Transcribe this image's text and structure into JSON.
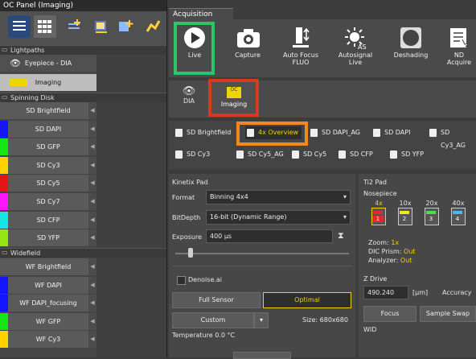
{
  "left_panel": {
    "title": "OC Panel (Imaging)",
    "sections": {
      "lightpaths": "Lightpaths",
      "spinning": "Spinning Disk",
      "widefield": "Widefield"
    },
    "lightpath_items": [
      {
        "label": "Eyepiece - DIA"
      },
      {
        "label": "Imaging"
      }
    ],
    "spinning_items": [
      {
        "label": "SD Brightfield",
        "color": "#5a5a5a"
      },
      {
        "label": "SD DAPI",
        "color": "#1414ff"
      },
      {
        "label": "SD GFP",
        "color": "#14e614"
      },
      {
        "label": "SD Cy3",
        "color": "#ffd200"
      },
      {
        "label": "SD Cy5",
        "color": "#e61414"
      },
      {
        "label": "SD Cy7",
        "color": "#ff14ff"
      },
      {
        "label": "SD CFP",
        "color": "#14e6e6"
      },
      {
        "label": "SD YFP",
        "color": "#96e614"
      }
    ],
    "widefield_items": [
      {
        "label": "WF Brightfield",
        "color": "#5a5a5a"
      },
      {
        "label": "WF DAPI",
        "color": "#1414ff"
      },
      {
        "label": "WF DAPI_focusing",
        "color": "#1414ff"
      },
      {
        "label": "WF GFP",
        "color": "#14e614"
      },
      {
        "label": "WF Cy3",
        "color": "#ffd200"
      }
    ]
  },
  "acquisition": {
    "tab": "Acquisition",
    "buttons": [
      "Live",
      "Capture",
      "Auto Focus FLUO",
      "Autosignal Live",
      "Deshading",
      "ND Acquire"
    ],
    "modes": [
      "DIA",
      "Imaging"
    ]
  },
  "presets": [
    "SD Brightfield",
    "4x Overview",
    "SD DAPI_AG",
    "SD DAPI",
    "SD Cy3_AG",
    "SD Cy3",
    "SD Cy5_AG",
    "SD Cy5",
    "SD CFP",
    "SD YFP"
  ],
  "kinetix": {
    "title": "Kinetix Pad",
    "format_label": "Format",
    "format_value": "Binning 4x4",
    "bitdepth_label": "BitDepth",
    "bitdepth_value": "16-bit (Dynamic Range)",
    "exposure_label": "Exposure",
    "exposure_value": "400 µs",
    "denoise": "Denoise.ai",
    "full_sensor": "Full Sensor",
    "optimal": "Optimal",
    "custom": "Custom",
    "size": "Size: 680x680",
    "temperature": "Temperature 0.0 °C"
  },
  "ti2": {
    "title": "Ti2 Pad",
    "nosepiece": "Nosepiece",
    "objectives": [
      {
        "mag": "4x",
        "num": "1",
        "color": "#e62828"
      },
      {
        "mag": "10x",
        "num": "2",
        "color": "#f0e628"
      },
      {
        "mag": "20x",
        "num": "3",
        "color": "#50dc50"
      },
      {
        "mag": "40x",
        "num": "4",
        "color": "#50b4f0"
      }
    ],
    "zoom_label": "Zoom:",
    "zoom_value": "1x",
    "dic_label": "DIC Prism:",
    "dic_value": "Out",
    "analyzer_label": "Analyzer:",
    "analyzer_value": "Out",
    "zdrive": "Z Drive",
    "z_value": "490.240",
    "z_unit": "[µm]",
    "accuracy": "Accuracy",
    "focus": "Focus",
    "sample_swap": "Sample Swap",
    "wid": "WID"
  },
  "colors": {
    "highlight_green": "#2ec46a",
    "highlight_red": "#d83a1e",
    "highlight_orange": "#f08a1e",
    "accent_yellow": "#f0d400"
  }
}
